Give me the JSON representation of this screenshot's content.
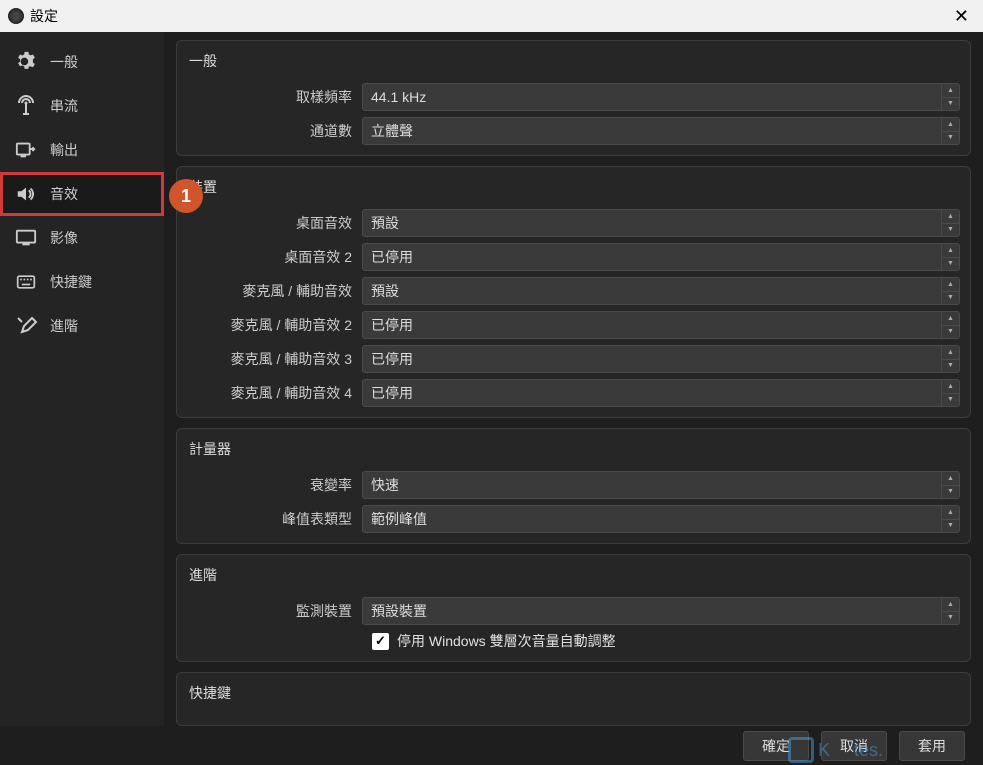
{
  "titlebar": {
    "title": "設定"
  },
  "sidebar": {
    "items": [
      {
        "label": "一般",
        "icon": "gear"
      },
      {
        "label": "串流",
        "icon": "stream"
      },
      {
        "label": "輸出",
        "icon": "output"
      },
      {
        "label": "音效",
        "icon": "audio",
        "active": true
      },
      {
        "label": "影像",
        "icon": "monitor"
      },
      {
        "label": "快捷鍵",
        "icon": "keyboard"
      },
      {
        "label": "進階",
        "icon": "tools"
      }
    ]
  },
  "annotation": {
    "badge": "1"
  },
  "groups": {
    "general": {
      "title": "一般",
      "sampleRate": {
        "label": "取樣頻率",
        "value": "44.1 kHz"
      },
      "channels": {
        "label": "通道數",
        "value": "立體聲"
      }
    },
    "devices": {
      "title": "裝置",
      "desktop1": {
        "label": "桌面音效",
        "value": "預設"
      },
      "desktop2": {
        "label": "桌面音效 2",
        "value": "已停用"
      },
      "mic1": {
        "label": "麥克風 / 輔助音效",
        "value": "預設"
      },
      "mic2": {
        "label": "麥克風 / 輔助音效 2",
        "value": "已停用"
      },
      "mic3": {
        "label": "麥克風 / 輔助音效 3",
        "value": "已停用"
      },
      "mic4": {
        "label": "麥克風 / 輔助音效 4",
        "value": "已停用"
      }
    },
    "meters": {
      "title": "計量器",
      "decay": {
        "label": "衰變率",
        "value": "快速"
      },
      "peakType": {
        "label": "峰值表類型",
        "value": "範例峰值"
      }
    },
    "advanced": {
      "title": "進階",
      "monitor": {
        "label": "監測裝置",
        "value": "預設裝置"
      },
      "ducking": {
        "label": "停用 Windows 雙層次音量自動調整",
        "checked": true
      }
    },
    "hotkeys": {
      "title": "快捷鍵"
    }
  },
  "footer": {
    "ok": "確定",
    "cancel": "取消",
    "apply": "套用"
  }
}
